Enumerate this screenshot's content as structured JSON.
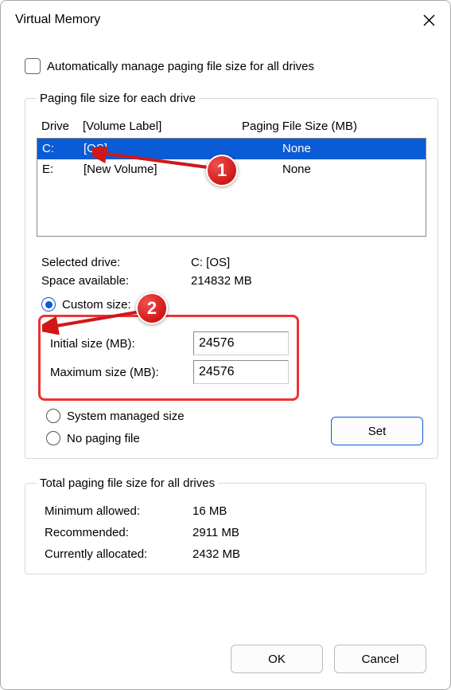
{
  "window": {
    "title": "Virtual Memory"
  },
  "auto_manage_label": "Automatically manage paging file size for all drives",
  "group1_legend": "Paging file size for each drive",
  "headers": {
    "drive": "Drive",
    "label": "[Volume Label]",
    "size": "Paging File Size (MB)"
  },
  "drives": [
    {
      "letter": "C:",
      "label": "[OS]",
      "size": "None",
      "selected": true
    },
    {
      "letter": "E:",
      "label": "[New Volume]",
      "size": "None",
      "selected": false
    }
  ],
  "selected_drive_label": "Selected drive:",
  "selected_drive_value": "C:  [OS]",
  "space_available_label": "Space available:",
  "space_available_value": "214832 MB",
  "radio": {
    "custom_label": "Custom size:",
    "system_label": "System managed size",
    "nofile_label": "No paging file"
  },
  "fields": {
    "initial_label": "Initial size (MB):",
    "initial_value": "24576",
    "maximum_label": "Maximum size (MB):",
    "maximum_value": "24576"
  },
  "set_button": "Set",
  "group2_legend": "Total paging file size for all drives",
  "totals": {
    "min_label": "Minimum allowed:",
    "min_value": "16 MB",
    "rec_label": "Recommended:",
    "rec_value": "2911 MB",
    "cur_label": "Currently allocated:",
    "cur_value": "2432 MB"
  },
  "buttons": {
    "ok": "OK",
    "cancel": "Cancel"
  },
  "annotations": {
    "m1": "1",
    "m2": "2"
  }
}
